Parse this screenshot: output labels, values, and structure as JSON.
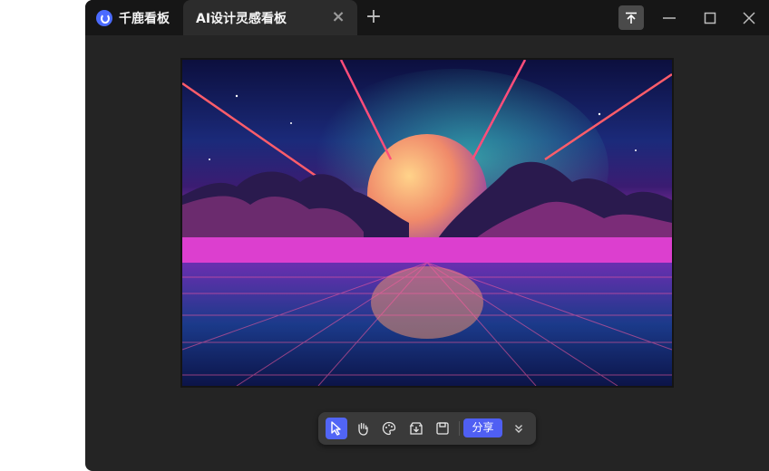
{
  "titlebar": {
    "brand_label": "千鹿看板",
    "active_tab_label": "AI设计灵感看板",
    "icons": [
      "brand-logo-icon",
      "close-icon",
      "plus-icon",
      "pin-top-icon",
      "minimize-icon",
      "maximize-icon",
      "close-window-icon"
    ]
  },
  "canvas": {
    "image_subject": "synthwave",
    "colors": {
      "sky": "#141a5a",
      "horizon": "#d83ccd",
      "moon": "#f3a36a",
      "laser": "#ff3d6e"
    }
  },
  "toolbar": {
    "tools": [
      "cursor-icon",
      "hand-icon",
      "palette-icon",
      "import-icon",
      "save-icon"
    ],
    "share_label": "分享",
    "more_icon": "double-chevron-down-icon"
  },
  "theme": {
    "accent": "#5165f6",
    "window_bg": "#242424",
    "titlebar_bg": "#161616"
  }
}
